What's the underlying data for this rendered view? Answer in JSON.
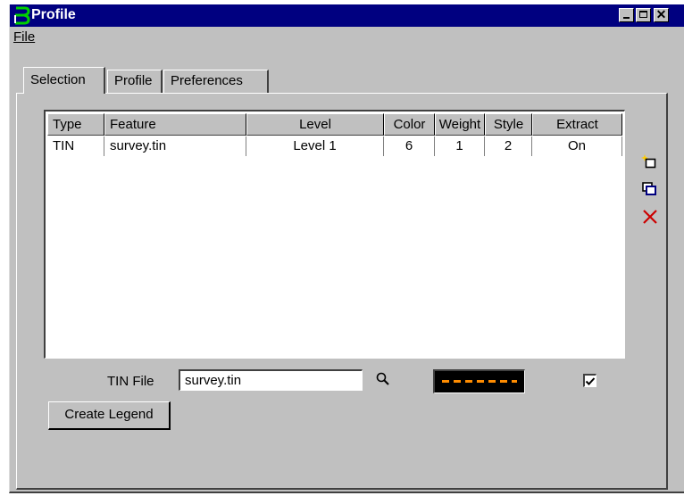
{
  "window": {
    "title": "Profile"
  },
  "menu": {
    "file": "File"
  },
  "tabs": [
    {
      "label": "Selection",
      "active": true
    },
    {
      "label": "Profile"
    },
    {
      "label": "Preferences"
    }
  ],
  "table": {
    "columns": [
      "Type",
      "Feature",
      "Level",
      "Color",
      "Weight",
      "Style",
      "Extract"
    ],
    "rows": [
      {
        "type": "TIN",
        "feature": "survey.tin",
        "level": "Level 1",
        "color": "6",
        "weight": "1",
        "style": "2",
        "extract": "On"
      }
    ]
  },
  "side_icons": [
    "new-row-icon",
    "copy-icon",
    "delete-icon"
  ],
  "tin_file": {
    "label": "TIN File",
    "value": "survey.tin"
  },
  "line_style_swatch": {
    "color": "#ff8c00",
    "background": "#000000"
  },
  "extract_checkbox": {
    "checked": true
  },
  "create_legend_button": "Create Legend"
}
